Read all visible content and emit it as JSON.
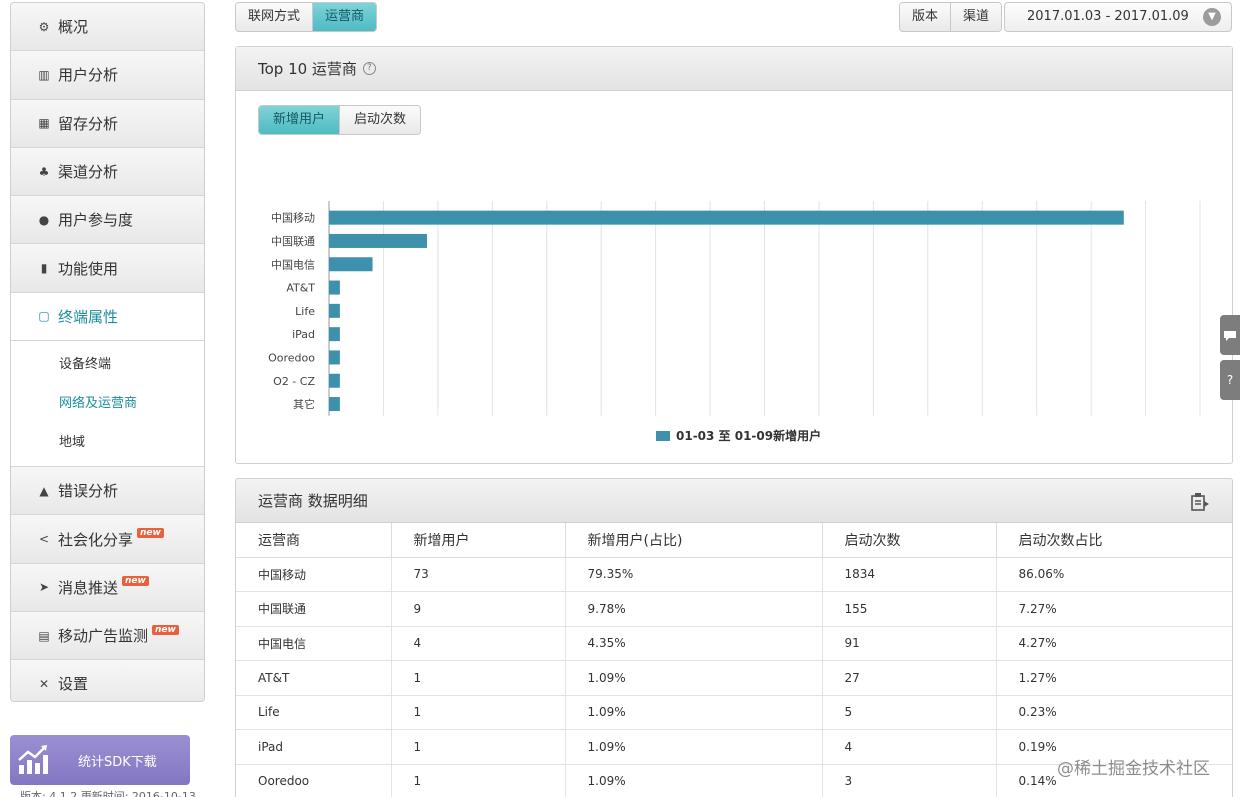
{
  "sidebar": {
    "items": [
      {
        "label": "概况",
        "icon": "dashboard-gear-icon"
      },
      {
        "label": "用户分析",
        "icon": "bar-chart-icon"
      },
      {
        "label": "留存分析",
        "icon": "grid-icon"
      },
      {
        "label": "渠道分析",
        "icon": "sitemap-icon"
      },
      {
        "label": "用户参与度",
        "icon": "user-icon"
      },
      {
        "label": "功能使用",
        "icon": "hand-icon"
      },
      {
        "label": "终端属性",
        "icon": "tablet-icon"
      }
    ],
    "subitems": [
      "设备终端",
      "网络及运营商",
      "地域"
    ],
    "items2": [
      {
        "label": "错误分析",
        "icon": "warning-icon"
      },
      {
        "label": "社会化分享",
        "icon": "share-icon",
        "badge": "new"
      },
      {
        "label": "消息推送",
        "icon": "send-icon",
        "badge": "new"
      },
      {
        "label": "移动广告监测",
        "icon": "ad-monitor-icon",
        "badge": "new"
      },
      {
        "label": "设置",
        "icon": "tools-icon"
      }
    ],
    "sdk_button": "统计SDK下载",
    "version_text": "版本: 4.1.2 更新时间: 2016-10-13"
  },
  "toolbar": {
    "tabs": [
      "联网方式",
      "运营商"
    ],
    "filters": [
      "版本",
      "渠道"
    ],
    "date_range": "2017.01.03 - 2017.01.09"
  },
  "top10": {
    "title": "Top 10 运营商",
    "tabs": [
      "新增用户",
      "启动次数"
    ],
    "legend": "01-03 至 01-09新增用户"
  },
  "chart_data": {
    "type": "bar",
    "orientation": "horizontal",
    "categories": [
      "中国移动",
      "中国联通",
      "中国电信",
      "AT&T",
      "Life",
      "iPad",
      "Ooredoo",
      "O2 - CZ",
      "其它"
    ],
    "series": [
      {
        "name": "01-03 至 01-09新增用户",
        "values": [
          73,
          9,
          4,
          1,
          1,
          1,
          1,
          1,
          1
        ]
      }
    ],
    "xlim": [
      0,
      80
    ],
    "xticks": [
      0,
      5,
      10,
      15,
      20,
      25,
      30,
      35,
      40,
      45,
      50,
      55,
      60,
      65,
      70,
      75,
      80
    ],
    "grid": true,
    "legend_position": "bottom",
    "color": "#3d91ad"
  },
  "detail": {
    "title": "运营商 数据明细",
    "columns": [
      "运营商",
      "新增用户",
      "新增用户(占比)",
      "启动次数",
      "启动次数占比"
    ],
    "rows": [
      [
        "中国移动",
        "73",
        "79.35%",
        "1834",
        "86.06%"
      ],
      [
        "中国联通",
        "9",
        "9.78%",
        "155",
        "7.27%"
      ],
      [
        "中国电信",
        "4",
        "4.35%",
        "91",
        "4.27%"
      ],
      [
        "AT&T",
        "1",
        "1.09%",
        "27",
        "1.27%"
      ],
      [
        "Life",
        "1",
        "1.09%",
        "5",
        "0.23%"
      ],
      [
        "iPad",
        "1",
        "1.09%",
        "4",
        "0.19%"
      ],
      [
        "Ooredoo",
        "1",
        "1.09%",
        "3",
        "0.14%"
      ]
    ]
  },
  "side_tabs": [
    "comment-icon",
    "help-icon"
  ],
  "watermark": "@稀土掘金技术社区"
}
